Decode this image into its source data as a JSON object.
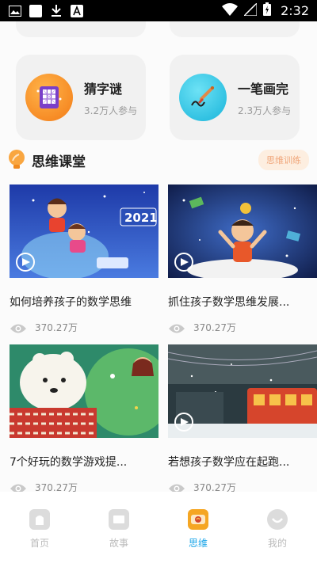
{
  "status_bar": {
    "time": "2:32"
  },
  "games": [
    {
      "title": "猜字谜",
      "participants": "3.2万人参与",
      "icon": "grid-board-icon"
    },
    {
      "title": "一笔画完",
      "participants": "2.3万人参与",
      "icon": "paintbrush-icon"
    }
  ],
  "section": {
    "title": "思维课堂",
    "tag": "思维训练"
  },
  "videos": [
    {
      "title": "如何培养孩子的数学思维",
      "views": "370.27万"
    },
    {
      "title": "抓住孩子数学思维发展...",
      "views": "370.27万"
    },
    {
      "title": "7个好玩的数学游戏提...",
      "views": "370.27万"
    },
    {
      "title": "若想孩子数学应在起跑...",
      "views": "370.27万"
    }
  ],
  "nav": [
    {
      "label": "首页",
      "icon": "home-icon"
    },
    {
      "label": "故事",
      "icon": "story-icon"
    },
    {
      "label": "思维",
      "icon": "thinking-icon",
      "active": true
    },
    {
      "label": "我的",
      "icon": "profile-icon"
    }
  ],
  "colors": {
    "accent": "#1aa5e8",
    "orange": "#f37a16",
    "cyan": "#18b4da"
  }
}
